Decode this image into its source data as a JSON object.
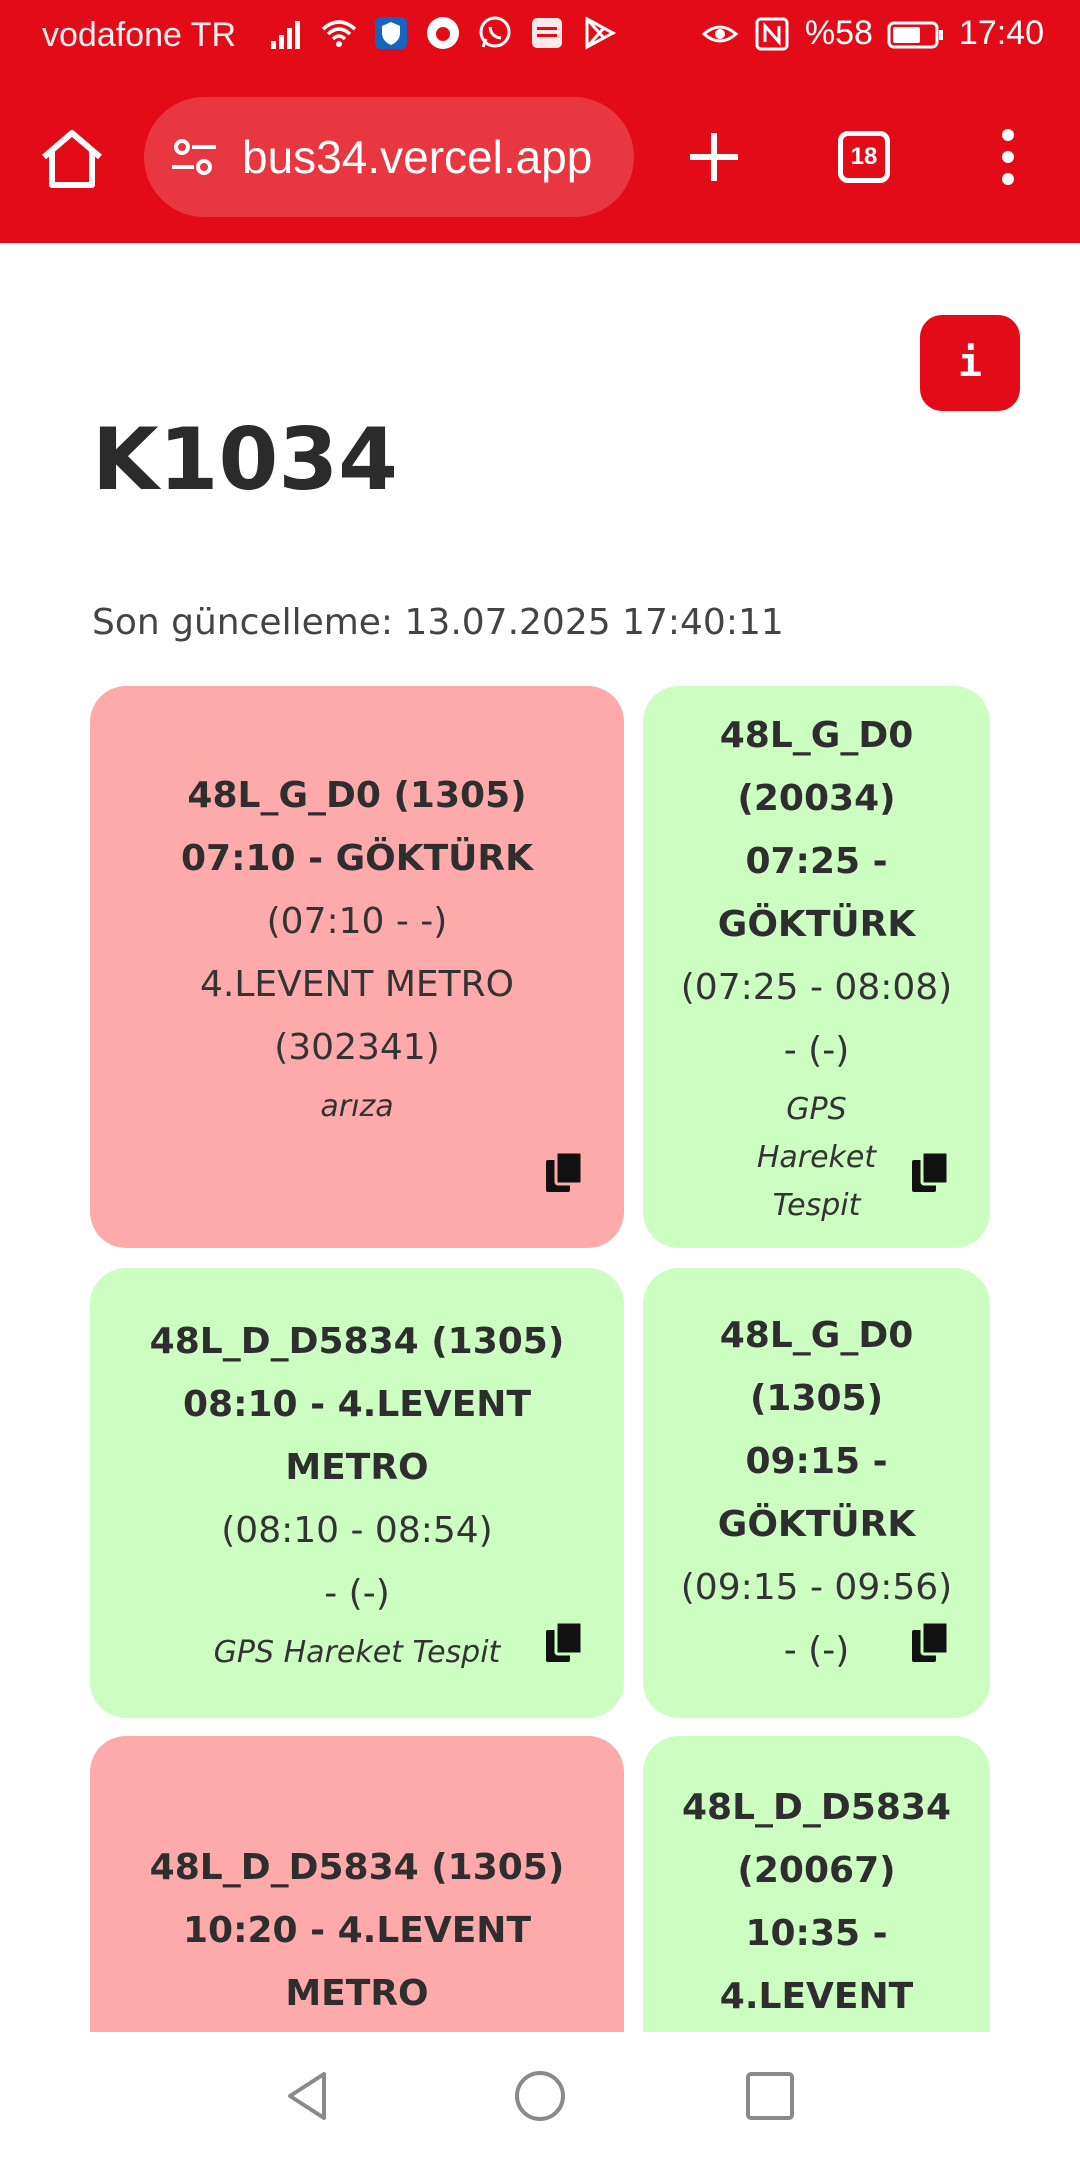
{
  "status_bar": {
    "carrier": "vodafone TR",
    "battery": "%58",
    "time": "17:40",
    "left_icons": [
      "signal-icon",
      "wifi-icon",
      "shield-app-icon",
      "vodafone-app-icon",
      "whatsapp-icon",
      "app-notification-icon",
      "play-store-icon"
    ],
    "right_icons": [
      "eye-comfort-icon",
      "nfc-icon",
      "battery-icon"
    ]
  },
  "browser": {
    "url": "bus34.vercel.app",
    "tab_count": "18",
    "theme_color": "#e30b17"
  },
  "page": {
    "title": "K1034",
    "info_label": "i",
    "last_update": "Son güncelleme: 13.07.2025 17:40:11"
  },
  "cards": [
    {
      "status": "red",
      "lines_bold": [
        "48L_G_D0 (1305)",
        "07:10 - GÖKTÜRK"
      ],
      "lines_normal": [
        "(07:10 - -)",
        "4.LEVENT METRO",
        "(302341)"
      ],
      "note": "arıza"
    },
    {
      "status": "green",
      "lines_bold": [
        "48L_G_D0",
        "(20034)",
        "07:25 -",
        "GÖKTÜRK"
      ],
      "lines_normal": [
        "(07:25 - 08:08)",
        "- (-)"
      ],
      "note": "GPS Hareket Tespit"
    },
    {
      "status": "green",
      "lines_bold": [
        "48L_D_D5834 (1305)",
        "08:10 - 4.LEVENT",
        "METRO"
      ],
      "lines_normal": [
        "(08:10 - 08:54)",
        "- (-)"
      ],
      "note": "GPS Hareket Tespit"
    },
    {
      "status": "green",
      "lines_bold": [
        "48L_G_D0",
        "(1305)",
        "09:15 -",
        "GÖKTÜRK"
      ],
      "lines_normal": [
        "(09:15 - 09:56)",
        "- (-)"
      ],
      "note": ""
    },
    {
      "status": "red",
      "lines_bold": [
        "48L_D_D5834 (1305)",
        "10:20 - 4.LEVENT",
        "METRO"
      ],
      "lines_normal": [],
      "note": ""
    },
    {
      "status": "green",
      "lines_bold": [
        "48L_D_D5834",
        "(20067)",
        "10:35 -",
        "4.LEVENT"
      ],
      "lines_normal": [],
      "note": ""
    }
  ],
  "colors": {
    "card_red": "#ffaaaa",
    "card_green": "#ccfec2",
    "accent": "#e30b17"
  },
  "nav": [
    "back-icon",
    "home-circle-icon",
    "recents-icon"
  ]
}
